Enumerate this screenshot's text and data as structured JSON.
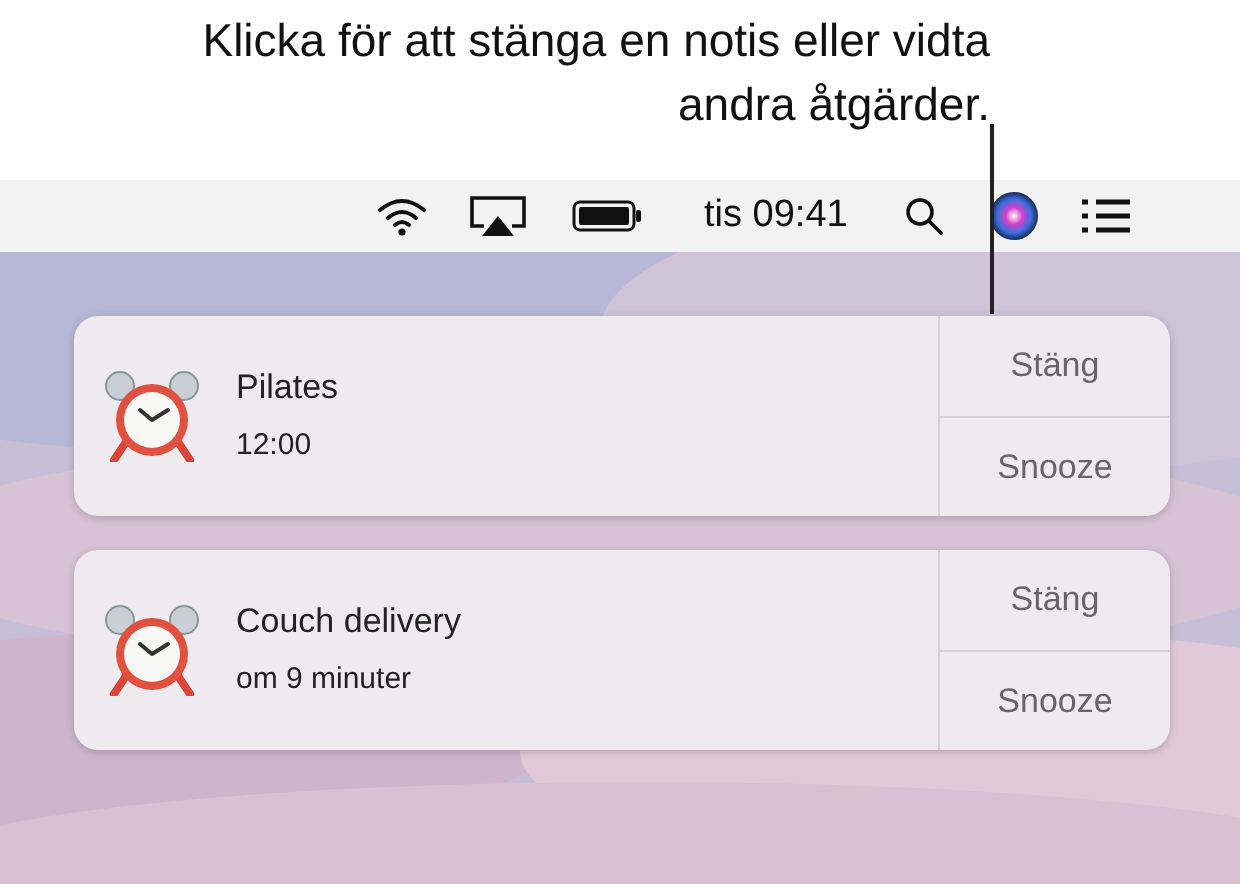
{
  "callout": "Klicka för att stänga en notis eller vidta andra åtgärder.",
  "menu_bar": {
    "clock": "tis 09:41"
  },
  "notifications": [
    {
      "title": "Pilates",
      "subtitle": "12:00",
      "actions": [
        "Stäng",
        "Snooze"
      ]
    },
    {
      "title": "Couch delivery",
      "subtitle": "om 9 minuter",
      "actions": [
        "Stäng",
        "Snooze"
      ]
    }
  ]
}
